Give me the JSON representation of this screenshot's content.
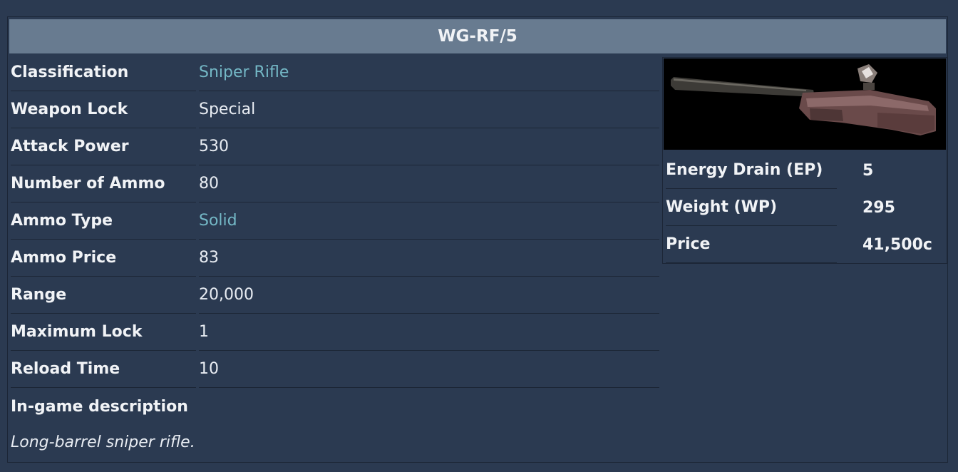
{
  "infobox": {
    "title": "WG-RF/5",
    "rows": [
      {
        "label": "Classification",
        "value": "Sniper Rifle"
      },
      {
        "label": "Weapon Lock",
        "value": "Special"
      },
      {
        "label": "Attack Power",
        "value": "530"
      },
      {
        "label": "Number of Ammo",
        "value": "80"
      },
      {
        "label": "Ammo Type",
        "value": "Solid"
      },
      {
        "label": "Ammo Price",
        "value": "83"
      },
      {
        "label": "Range",
        "value": "20,000"
      },
      {
        "label": "Maximum Lock",
        "value": "1"
      },
      {
        "label": "Reload Time",
        "value": "10"
      }
    ],
    "description_heading": "In-game description",
    "description": "Long-barrel sniper rifle."
  },
  "side": {
    "image_alt": "sniper-rifle-image",
    "stats": [
      {
        "label": "Energy Drain (EP)",
        "value": "5"
      },
      {
        "label": "Weight (WP)",
        "value": "295"
      },
      {
        "label": "Price",
        "value": "41,500c"
      }
    ]
  },
  "colors": {
    "background": "#2b3a51",
    "title_bar": "#687b90",
    "link": "#74b8c6"
  }
}
